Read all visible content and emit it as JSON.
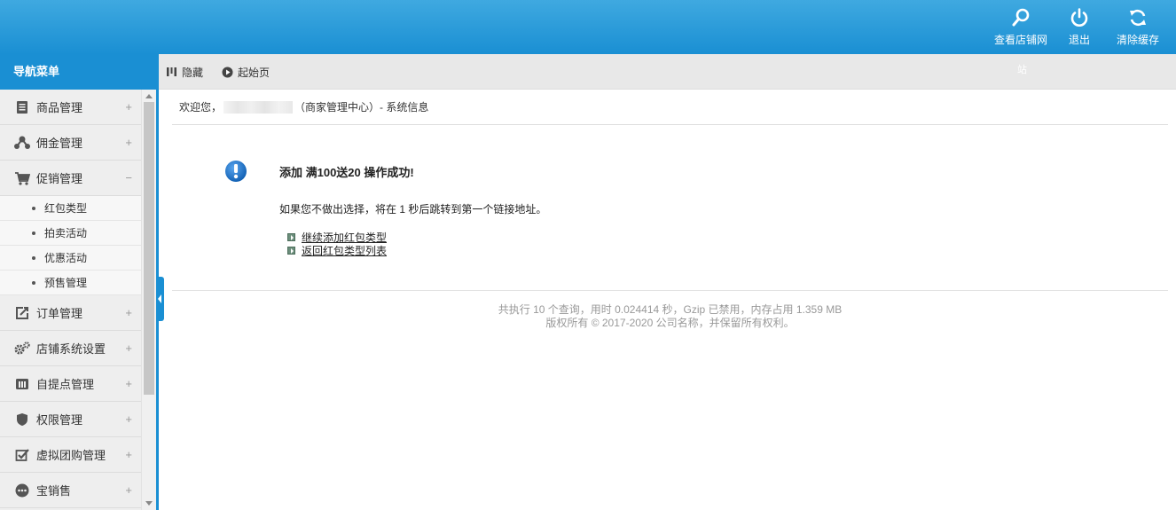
{
  "header": {
    "actions": [
      {
        "label": "查看店铺网",
        "icon": "search-icon"
      },
      {
        "label": "退出",
        "icon": "power-icon"
      },
      {
        "label": "清除缓存",
        "icon": "refresh-icon"
      }
    ],
    "colors": {
      "top_bar": "#1a8fd3",
      "accent": "#1a8fd3"
    }
  },
  "sidebar": {
    "title": "导航菜单",
    "items": [
      {
        "label": "商品管理",
        "icon": "product-icon",
        "toggle": "+"
      },
      {
        "label": "佣金管理",
        "icon": "share-icon",
        "toggle": "+"
      },
      {
        "label": "促销管理",
        "icon": "cart-icon",
        "toggle": "−",
        "children": [
          {
            "label": "红包类型"
          },
          {
            "label": "拍卖活动"
          },
          {
            "label": "优惠活动"
          },
          {
            "label": "预售管理"
          }
        ]
      },
      {
        "label": "订单管理",
        "icon": "order-icon",
        "toggle": "+"
      },
      {
        "label": "店铺系统设置",
        "icon": "gears-icon",
        "toggle": "+"
      },
      {
        "label": "自提点管理",
        "icon": "pickup-icon",
        "toggle": "+"
      },
      {
        "label": "权限管理",
        "icon": "shield-icon",
        "toggle": "+"
      },
      {
        "label": "虚拟团购管理",
        "icon": "checkbox-icon",
        "toggle": "+"
      },
      {
        "label": "宝销售",
        "icon": "more-icon",
        "toggle": "+"
      }
    ]
  },
  "toolbar": {
    "hide_label": "隐藏",
    "start_label": "起始页",
    "site_label": "站"
  },
  "breadcrumb": {
    "welcome": "欢迎您，",
    "context": "（商家管理中心）- 系统信息"
  },
  "message": {
    "title": "添加 满100送20 操作成功!",
    "note": "如果您不做出选择，将在 1 秒后跳转到第一个链接地址。",
    "links": [
      {
        "label": "继续添加红包类型"
      },
      {
        "label": "返回红包类型列表"
      }
    ]
  },
  "footer": {
    "stats": "共执行 10 个查询，用时 0.024414 秒，Gzip 已禁用，内存占用 1.359 MB",
    "copyright": "版权所有 © 2017-2020 公司名称，并保留所有权利。"
  }
}
